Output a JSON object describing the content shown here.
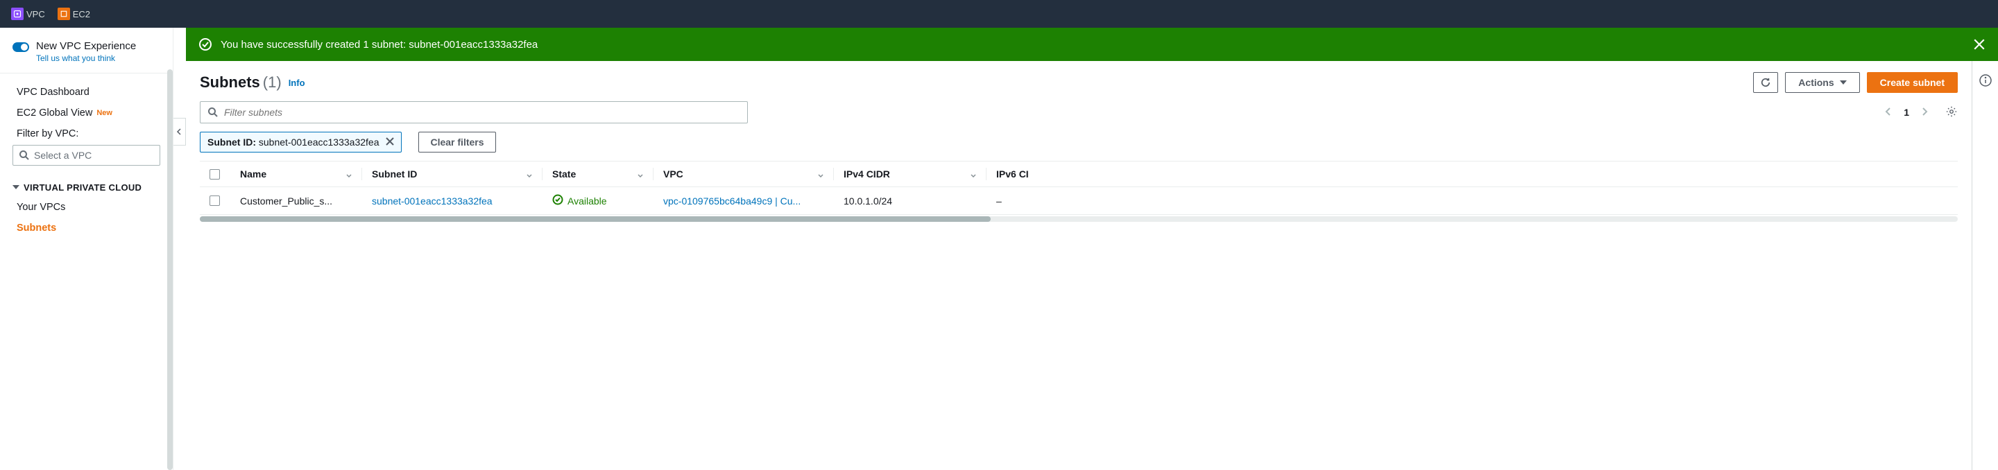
{
  "top_nav": {
    "services": [
      {
        "label": "VPC"
      },
      {
        "label": "EC2"
      }
    ]
  },
  "sidebar": {
    "experience": {
      "title": "New VPC Experience",
      "feedback": "Tell us what you think"
    },
    "items": {
      "dashboard": "VPC Dashboard",
      "ec2_global": "EC2 Global View",
      "new_badge": "New",
      "filter_label": "Filter by VPC:",
      "vpc_select_placeholder": "Select a VPC",
      "section_heading": "VIRTUAL PRIVATE CLOUD",
      "your_vpcs": "Your VPCs",
      "subnets": "Subnets"
    }
  },
  "banner": {
    "message": "You have successfully created 1 subnet: subnet-001eacc1333a32fea"
  },
  "page": {
    "title": "Subnets",
    "count": "(1)",
    "info": "Info"
  },
  "actions": {
    "actions_label": "Actions",
    "create_label": "Create subnet"
  },
  "search": {
    "placeholder": "Filter subnets"
  },
  "pager": {
    "page": "1"
  },
  "filters": {
    "chip_label": "Subnet ID:",
    "chip_value": "subnet-001eacc1333a32fea",
    "clear": "Clear filters"
  },
  "table": {
    "headers": {
      "name": "Name",
      "subnet_id": "Subnet ID",
      "state": "State",
      "vpc": "VPC",
      "ipv4": "IPv4 CIDR",
      "ipv6": "IPv6 CI"
    },
    "rows": [
      {
        "name": "Customer_Public_s...",
        "subnet_id": "subnet-001eacc1333a32fea",
        "state": "Available",
        "vpc": "vpc-0109765bc64ba49c9 | Cu...",
        "ipv4": "10.0.1.0/24",
        "ipv6": "–"
      }
    ]
  }
}
